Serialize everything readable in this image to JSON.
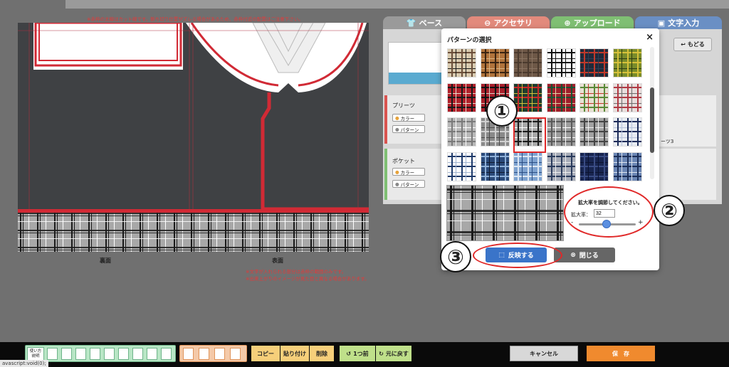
{
  "notice": "※赤枠の太線はカット線です。断ち切り位置がズレる場合があるため、赤枠付近の配置はご注意下さい。",
  "garment": {
    "back_label": "裏面",
    "front_label": "表面",
    "notes": [
      "※文字が入れられる部分は赤枠の範囲のみです。",
      "※出来上がりのイメージが見た目と異なる場合があります。"
    ]
  },
  "tabs": [
    {
      "label": "ベース",
      "icon": "shirt-icon",
      "color": "#9a9a9a"
    },
    {
      "label": "アクセサリ",
      "icon": "circle-icon",
      "color": "#e28a7c"
    },
    {
      "label": "アップロード",
      "icon": "upload-icon",
      "color": "#7fbf73"
    },
    {
      "label": "文字入力",
      "icon": "text-icon",
      "color": "#6a8fc4"
    }
  ],
  "back_button": "もどる",
  "parts_list_item": "ーツ3",
  "sections": [
    {
      "title": "プリーツ",
      "color_label": "カラー",
      "pattern_label": "パターン",
      "bar": "#d9534f"
    },
    {
      "title": "ポケット",
      "color_label": "カラー",
      "pattern_label": "パターン",
      "bar": "#7fbf73"
    }
  ],
  "modal": {
    "title": "パターンの選択",
    "close_symbol": "×",
    "zoom_instruction": "拡大率を調節してください。",
    "zoom_label": "拡大率：",
    "zoom_value": "32",
    "minus": "-",
    "plus": "+",
    "slider_fraction": 0.49,
    "apply_label": "反映する",
    "close_label": "閉じる",
    "selected_index": 14
  },
  "callouts": [
    "①",
    "②",
    "③"
  ],
  "swatches": [
    {
      "bg": "#d9cbb0",
      "c1": "#6b4f3a",
      "c2": "#1a1a1a"
    },
    {
      "bg": "#b0733b",
      "c1": "#3a2412",
      "c2": "#d9b180"
    },
    {
      "bg": "#6e5847",
      "c1": "#4a3a2e",
      "c2": "#8a7462"
    },
    {
      "bg": "#ffffff",
      "c1": "#111111",
      "c2": "#111111"
    },
    {
      "bg": "#1f2a3a",
      "c1": "#c0392b",
      "c2": "#2d3e56"
    },
    {
      "bg": "#7a8c2a",
      "c1": "#d7c13a",
      "c2": "#2c3b12"
    },
    {
      "bg": "#b2202a",
      "c1": "#1a1a1a",
      "c2": "#e8e0d0"
    },
    {
      "bg": "#a71f2b",
      "c1": "#111111",
      "c2": "#d8d2c6"
    },
    {
      "bg": "#1e3d2e",
      "c1": "#c42b2b",
      "c2": "#d6c13a"
    },
    {
      "bg": "#a01e2b",
      "c1": "#1b5233",
      "c2": "#e2d6a8"
    },
    {
      "bg": "#e8e1d4",
      "c1": "#5a8a3a",
      "c2": "#c0392b"
    },
    {
      "bg": "#e8dedd",
      "c1": "#b23a44",
      "c2": "#6b6b6b"
    },
    {
      "bg": "#b8b8b8",
      "c1": "#7a7a7a",
      "c2": "#ffffff"
    },
    {
      "bg": "#8a8a8a",
      "c1": "#d0d0d0",
      "c2": "#4a4a4a"
    },
    {
      "bg": "#a8a8a8",
      "c1": "#1a1a1a",
      "c2": "#ffffff"
    },
    {
      "bg": "#9c9c9c",
      "c1": "#5a5a5a",
      "c2": "#ffffff"
    },
    {
      "bg": "#a2a2a2",
      "c1": "#444444",
      "c2": "#f0f0f0"
    },
    {
      "bg": "#e8ecf2",
      "c1": "#1e2d5a",
      "c2": "#b8c4dc"
    },
    {
      "bg": "#ffffff",
      "c1": "#1e3a6a",
      "c2": "#9fb3cf"
    },
    {
      "bg": "#2b4a7a",
      "c1": "#8fb0d8",
      "c2": "#111a2e"
    },
    {
      "bg": "#7fa3d0",
      "c1": "#dde7f3",
      "c2": "#2c4f84"
    },
    {
      "bg": "#a7acb8",
      "c1": "#2a3b5c",
      "c2": "#f0f0f0"
    },
    {
      "bg": "#182550",
      "c1": "#3a4c84",
      "c2": "#0b1330"
    },
    {
      "bg": "#6b86b4",
      "c1": "#1c2f58",
      "c2": "#e0e6f0"
    }
  ],
  "preview": {
    "bg": "#a8a8a8",
    "c1": "#1a1a1a",
    "c2": "#ffffff"
  },
  "toolbar": {
    "howto_label": "使い方\n説明",
    "copy": "コピー",
    "paste": "貼り付け",
    "delete": "削除",
    "undo": "1つ前",
    "redo": "元に戻す",
    "cancel": "キャンセル",
    "save": "保　存"
  },
  "status_text": "avascript:void(0);"
}
